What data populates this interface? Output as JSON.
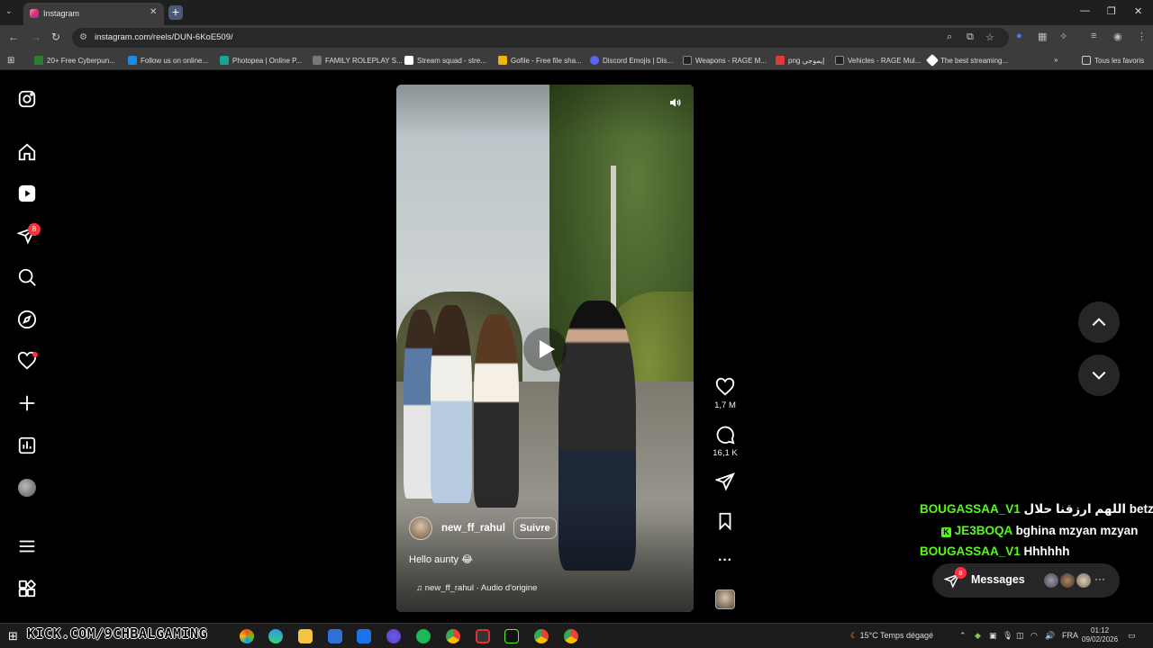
{
  "browser": {
    "tab_title": "Instagram",
    "url": "instagram.com/reels/DUN-6KoE509/",
    "bookmarks": [
      {
        "label": "20+ Free Cyberpun...",
        "color": "#2e7d32"
      },
      {
        "label": "Follow us on online...",
        "color": "#1e88e5"
      },
      {
        "label": "Photopea | Online P...",
        "color": "#18a497"
      },
      {
        "label": "FAMILY ROLEPLAY S...",
        "color": "#777777"
      },
      {
        "label": "Stream squad - stre...",
        "color": "#ffffff"
      },
      {
        "label": "Gofile - Free file sha...",
        "color": "#f4b400"
      },
      {
        "label": "Discord Emojis | Dis...",
        "color": "#5865f2"
      },
      {
        "label": "Weapons - RAGE M...",
        "color": "#222222"
      },
      {
        "label": "png إيموجي",
        "color": "#e53935"
      },
      {
        "label": "Vehicles - RAGE Mul...",
        "color": "#222222"
      },
      {
        "label": "The best streaming...",
        "color": "#ffffff"
      }
    ],
    "all_bookmarks": "Tous les favoris"
  },
  "sidebar": {
    "notification_count": "8",
    "items": [
      "instagram-logo",
      "home",
      "reels",
      "messages",
      "search",
      "explore",
      "notifications",
      "create",
      "dashboard",
      "profile",
      "more",
      "also-from-meta"
    ]
  },
  "reel": {
    "owner": "new_ff_rahul",
    "follow_label": "Suivre",
    "caption": "Hello aunty 😂",
    "audio": "new_ff_rahul · Audio d'origine",
    "likes": "1,7 M",
    "comments": "16,1 K"
  },
  "chat": [
    {
      "user": "BOUGASSAA_V1",
      "message": "اللهم ارزقنا حلال betzed",
      "badge": false
    },
    {
      "user": "JE3BOQA",
      "message": "bghina mzyan mzyan",
      "badge": true
    },
    {
      "user": "BOUGASSAA_V1",
      "message": "Hhhhhh",
      "badge": false
    }
  ],
  "messages": {
    "label": "Messages",
    "badge": "8"
  },
  "taskbar": {
    "banner": "KICK.COM/9CHBALGAMING",
    "weather": "15°C  Temps dégagé",
    "language": "FRA",
    "time": "01:12",
    "date": "09/02/2026"
  },
  "colors": {
    "kick_green": "#53fc18",
    "badge_red": "#ff3040"
  }
}
